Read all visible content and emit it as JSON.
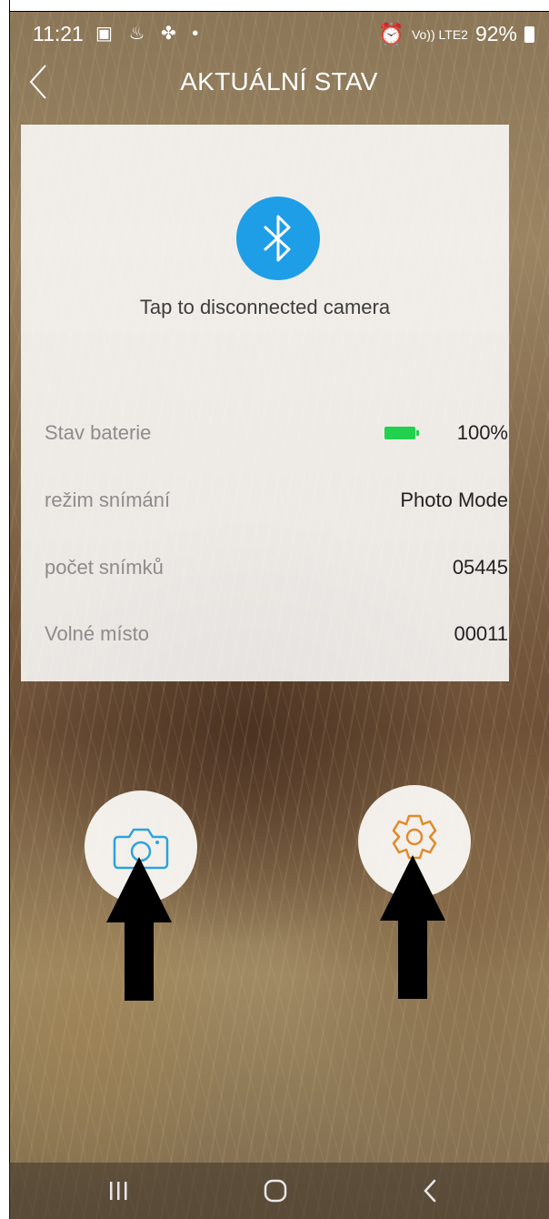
{
  "status_bar": {
    "time": "11:21",
    "left_icons": "▣ ♨ ✤ •",
    "signal_text": "Vo)) LTE2",
    "battery_percent": "92%"
  },
  "header": {
    "title": "AKTUÁLNÍ STAV",
    "back_icon": "chevron-left-icon"
  },
  "connection": {
    "icon": "bluetooth-icon",
    "caption": "Tap to disconnected camera",
    "accent_color": "#1f9ee8"
  },
  "info": {
    "battery": {
      "label": "Stav baterie",
      "value": "100%",
      "level": 1.0,
      "color": "#22d14d"
    },
    "capture_mode": {
      "label": "režim snímání",
      "value": "Photo Mode"
    },
    "photo_count": {
      "label": "počet snímků",
      "value": "05445"
    },
    "free_space": {
      "label": "Volné místo",
      "value": "00011"
    }
  },
  "actions": {
    "camera": {
      "icon": "camera-icon",
      "color": "#2ba3de"
    },
    "settings": {
      "icon": "gear-icon",
      "color": "#e08a2c"
    }
  },
  "nav_bar": {
    "recent": "recent-apps-icon",
    "home": "home-icon",
    "back": "back-icon"
  }
}
